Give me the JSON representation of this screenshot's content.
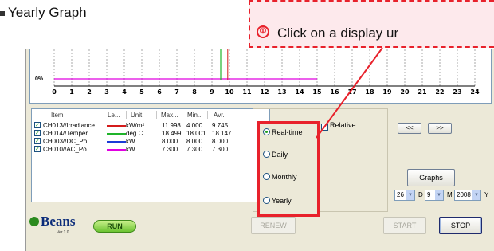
{
  "page_heading": "Yearly Graph",
  "callout": {
    "number": "①",
    "text": "Click on a display ur"
  },
  "chart": {
    "y_label": "0%",
    "x_ticks": [
      "0",
      "1",
      "2",
      "3",
      "4",
      "5",
      "6",
      "7",
      "8",
      "9",
      "10",
      "11",
      "12",
      "13",
      "14",
      "15",
      "16",
      "17",
      "18",
      "19",
      "20",
      "21",
      "22",
      "23",
      "24"
    ],
    "colors": {
      "grid": "#aaaaaa",
      "magenta": "#e100e1",
      "green": "#1fb42a",
      "red": "#d41b1b"
    }
  },
  "item_table": {
    "headers": [
      "Item",
      "Le...",
      "Unit",
      "Max...",
      "Min...",
      "Avr."
    ],
    "rows": [
      {
        "item": "CH013//Irradiance",
        "color": "#d41b1b",
        "unit": "kW/m²",
        "max": "11.998",
        "min": "4.000",
        "avr": "9.745"
      },
      {
        "item": "CH014//Temper...",
        "color": "#1fb42a",
        "unit": "deg C",
        "max": "18.499",
        "min": "18.001",
        "avr": "18.147"
      },
      {
        "item": "CH003//DC_Po...",
        "color": "#1a3bd6",
        "unit": "kW",
        "max": "8.000",
        "min": "8.000",
        "avr": "8.000"
      },
      {
        "item": "CH010//AC_Po...",
        "color": "#e100e1",
        "unit": "kW",
        "max": "7.300",
        "min": "7.300",
        "avr": "7.300"
      }
    ]
  },
  "modes": {
    "realtime": "Real-time",
    "daily": "Daily",
    "monthly": "Monthly",
    "yearly": "Yearly",
    "selected": "realtime"
  },
  "relative_label": "Relative",
  "nav": {
    "prev": "<<",
    "next": ">>"
  },
  "date": {
    "day_value": "26",
    "day_label": "D",
    "month_value": "9",
    "month_label": "M",
    "year_value": "2008",
    "year_label": "Y"
  },
  "buttons": {
    "graphs": "Graphs",
    "renew": "RENEW",
    "start": "START",
    "stop": "STOP"
  },
  "logo": {
    "name": "Beans",
    "version": "Ver.1.0"
  },
  "run_badge": "RUN"
}
